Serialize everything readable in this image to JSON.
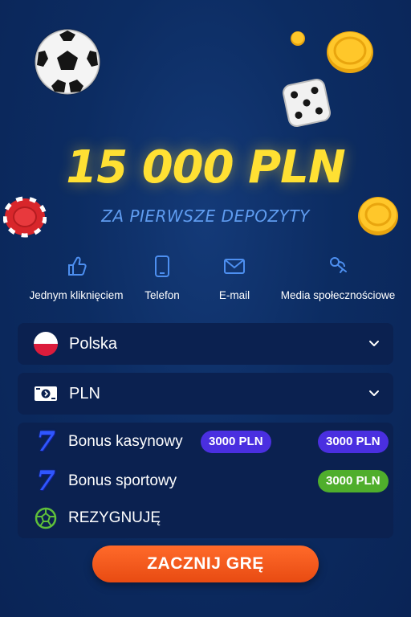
{
  "hero": {
    "amount": "15 000 PLN",
    "subtitle": "ZA PIERWSZE DEPOZYTY"
  },
  "registration_methods": [
    {
      "label": "Jednym kliknięciem",
      "icon": "thumbs-up-icon"
    },
    {
      "label": "Telefon",
      "icon": "phone-icon"
    },
    {
      "label": "E-mail",
      "icon": "mail-icon"
    },
    {
      "label": "Media społecznościowe",
      "icon": "social-icon"
    }
  ],
  "country": {
    "label": "Polska",
    "icon": "poland-flag-icon"
  },
  "currency": {
    "label": "PLN",
    "icon": "money-icon"
  },
  "bonuses": [
    {
      "label": "Bonus kasynowy",
      "amount_inline": "3000 PLN",
      "amount": "3000 PLN",
      "icon": "lucky-seven-icon"
    },
    {
      "label": "Bonus sportowy",
      "amount": "3000 PLN",
      "icon": "lucky-seven-icon"
    },
    {
      "label": "REZYGNUJĘ",
      "icon": "cancel-circle-icon"
    }
  ],
  "cta": {
    "label": "ZACZNIJ GRĘ"
  },
  "colors": {
    "background": "#0c2c62",
    "amount": "#ffe033",
    "subtitle": "#5f9cf0",
    "icon_blue": "#4d8ff0",
    "pill_purple": "#4a2fe0",
    "pill_green": "#4fae2c",
    "cta": "#f25a1d"
  }
}
